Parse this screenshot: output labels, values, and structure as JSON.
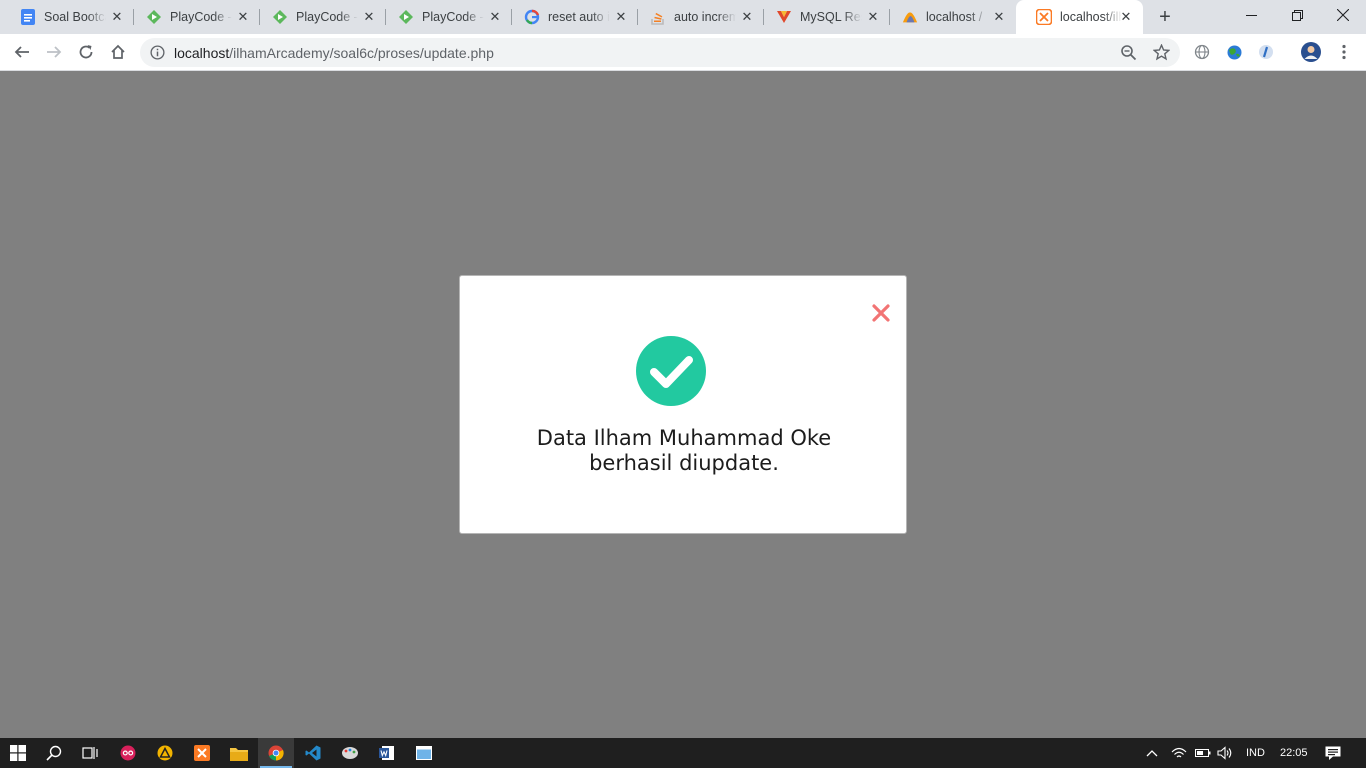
{
  "browser": {
    "tabs": [
      {
        "title": "Soal Bootcamp",
        "icon": "docs-icon"
      },
      {
        "title": "PlayCode - ",
        "icon": "playcode-icon"
      },
      {
        "title": "PlayCode - ",
        "icon": "playcode-icon"
      },
      {
        "title": "PlayCode - ",
        "icon": "playcode-icon"
      },
      {
        "title": "reset auto in",
        "icon": "google-icon"
      },
      {
        "title": "auto increm",
        "icon": "stackoverflow-icon"
      },
      {
        "title": "MySQL Res",
        "icon": "mysql-icon"
      },
      {
        "title": "localhost / ",
        "icon": "phpmyadmin-icon"
      },
      {
        "title": "localhost/ilh",
        "icon": "xampp-icon",
        "active": true
      }
    ],
    "new_tab_label": "+",
    "url_host": "localhost",
    "url_path": "/ilhamArcademy/soal6c/proses/update.php"
  },
  "modal": {
    "message": "Data Ilham Muhammad Oke berhasil diupdate.",
    "close_label": "×",
    "success_color": "#22c9a0",
    "close_color": "#f27474"
  },
  "taskbar": {
    "language": "IND",
    "time": "22:05"
  }
}
